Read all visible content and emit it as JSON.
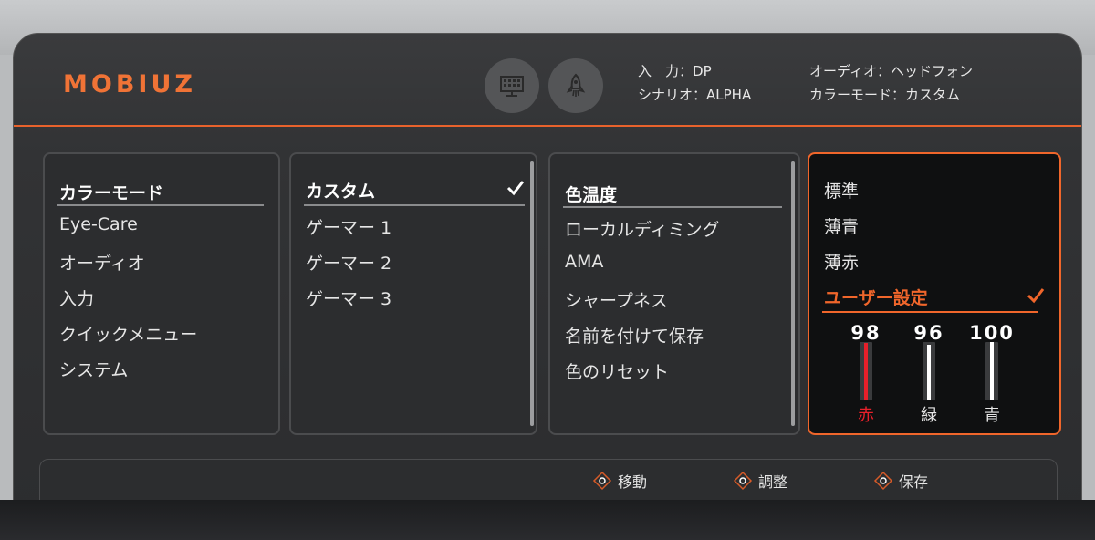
{
  "header": {
    "logo": "MOBIUZ",
    "icons": [
      "monitor-grid-icon",
      "rocket-icon"
    ],
    "info": {
      "input_label": "入　力：",
      "input_value": "DP",
      "scenario_label": "シナリオ：",
      "scenario_value": "ALPHA",
      "audio_label": "オーディオ：",
      "audio_value": "ヘッドフォン",
      "color_mode_label": "カラーモード：",
      "color_mode_value": "カスタム"
    }
  },
  "menu_main": {
    "items": [
      "カラーモード",
      "Eye-Care",
      "オーディオ",
      "入力",
      "クイックメニュー",
      "システム"
    ]
  },
  "menu_color_mode": {
    "items": [
      "カスタム",
      "ゲーマー 1",
      "ゲーマー 2",
      "ゲーマー 3"
    ],
    "selected": "カスタム"
  },
  "menu_custom": {
    "items": [
      "色温度",
      "ローカルディミング",
      "AMA",
      "シャープネス",
      "名前を付けて保存",
      "色のリセット"
    ]
  },
  "menu_color_temp": {
    "items": [
      "標準",
      "薄青",
      "薄赤",
      "ユーザー設定"
    ],
    "selected": "ユーザー設定",
    "sliders": [
      {
        "label": "赤",
        "value": "98",
        "level": 0.98
      },
      {
        "label": "緑",
        "value": "96",
        "level": 0.96
      },
      {
        "label": "青",
        "value": "100",
        "level": 1.0
      }
    ]
  },
  "footer": {
    "hints": [
      "移動",
      "調整",
      "保存"
    ]
  },
  "colors": {
    "accent": "#f0662b",
    "red_slider": "#e8202a",
    "text": "#e6e6e6"
  }
}
